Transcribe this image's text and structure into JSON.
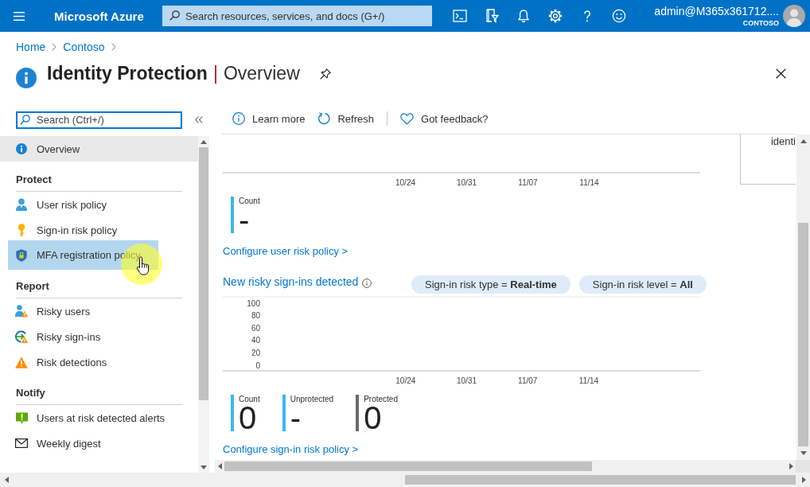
{
  "topbar": {
    "brand": "Microsoft Azure",
    "search": {
      "placeholder": "Search resources, services, and docs (G+/)"
    },
    "account": {
      "user": "admin@M365x361712....",
      "tenant": "CONTOSO"
    }
  },
  "breadcrumb": [
    "Home",
    "Contoso"
  ],
  "header": {
    "title": "Identity Protection",
    "separator": "|",
    "subtitle": "Overview"
  },
  "sidebar": {
    "search": {
      "placeholder": "Search (Ctrl+/)"
    },
    "items": [
      {
        "label": "Overview",
        "selected": true,
        "hovered": false
      }
    ],
    "groups": [
      {
        "heading": "Protect",
        "items": [
          {
            "label": "User risk policy",
            "selected": false,
            "hovered": false
          },
          {
            "label": "Sign-in risk policy",
            "selected": false,
            "hovered": false
          },
          {
            "label": "MFA registration policy",
            "selected": false,
            "hovered": true
          }
        ]
      },
      {
        "heading": "Report",
        "items": [
          {
            "label": "Risky users",
            "selected": false,
            "hovered": false
          },
          {
            "label": "Risky sign-ins",
            "selected": false,
            "hovered": false
          },
          {
            "label": "Risk detections",
            "selected": false,
            "hovered": false
          }
        ]
      },
      {
        "heading": "Notify",
        "items": [
          {
            "label": "Users at risk detected alerts",
            "selected": false,
            "hovered": false
          },
          {
            "label": "Weekly digest",
            "selected": false,
            "hovered": false
          }
        ]
      }
    ]
  },
  "toolbar": [
    {
      "label": "Learn more"
    },
    {
      "label": "Refresh"
    },
    {
      "label": "Got feedback?"
    }
  ],
  "user_risk_section": {
    "axis_labels": [
      "10/24",
      "10/31",
      "11/07",
      "11/14"
    ],
    "legend": [
      {
        "label": "Count",
        "value": "-",
        "color": "#3cb7f0"
      }
    ],
    "link": "Configure user risk policy >"
  },
  "side_card": {
    "text": "identi"
  },
  "signin_section": {
    "title": "New risky sign-ins detected",
    "filters": [
      "Sign-in risk type = **Real-time**",
      "Sign-in risk level = **All**"
    ],
    "chart_data": {
      "type": "line",
      "categories": [
        null,
        null,
        "10/24",
        "10/31",
        "11/07",
        "11/14",
        null
      ],
      "ylim": [
        0,
        100
      ],
      "yticks": [
        0,
        20,
        40,
        60,
        80,
        100
      ]
    },
    "legend": [
      {
        "label": "Count",
        "value": "0",
        "color": "#3cb7f0"
      },
      {
        "label": "Unprotected",
        "value": "-",
        "color": "#3cb7f0"
      },
      {
        "label": "Protected",
        "value": "0",
        "color": "#6b6b6b"
      }
    ],
    "link": "Configure sign-in risk policy >"
  }
}
